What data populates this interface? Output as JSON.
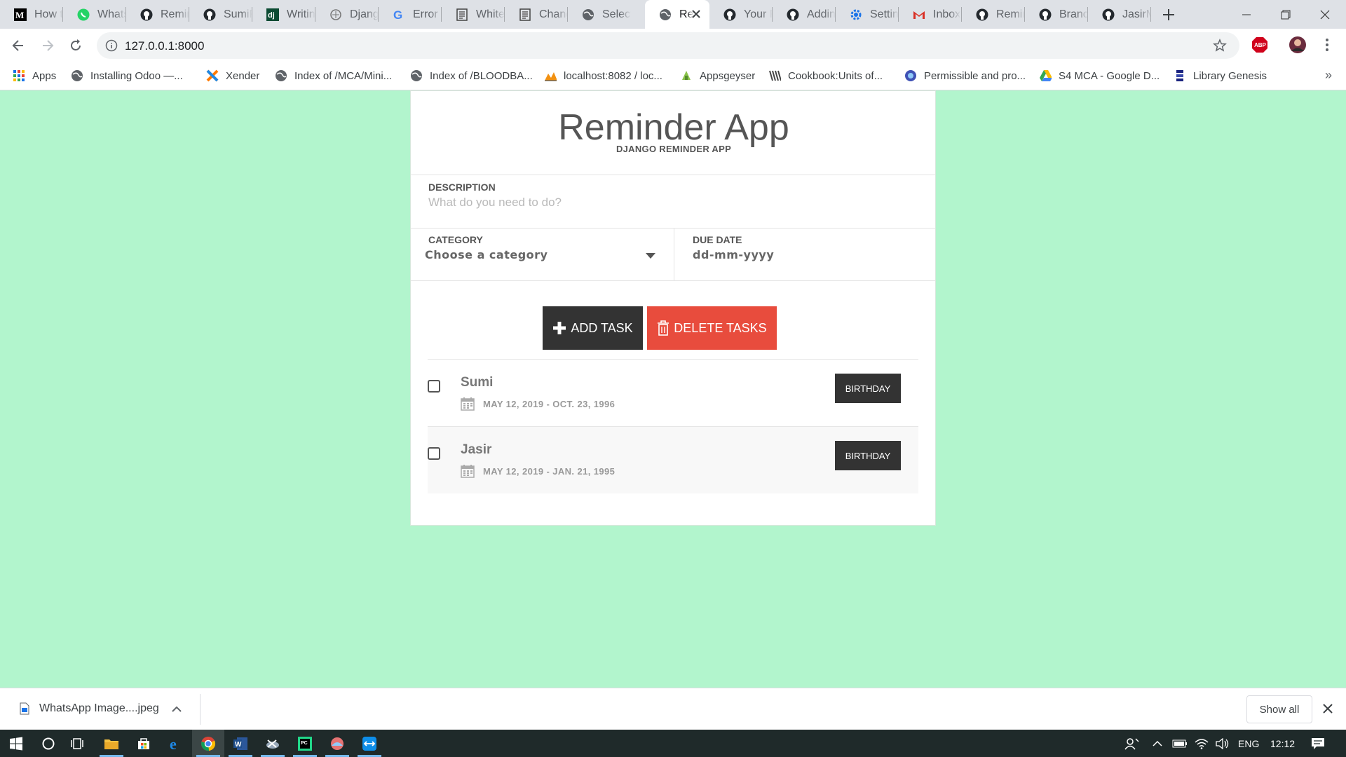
{
  "browser": {
    "tabs": [
      {
        "title": "How t",
        "icon": "medium-icon"
      },
      {
        "title": "Whats",
        "icon": "whatsapp-icon"
      },
      {
        "title": "Remin",
        "icon": "github-icon"
      },
      {
        "title": "SumiP",
        "icon": "github-icon"
      },
      {
        "title": "Writin",
        "icon": "django-icon"
      },
      {
        "title": "Djang",
        "icon": "generic-icon"
      },
      {
        "title": "Error c",
        "icon": "google-icon"
      },
      {
        "title": "White",
        "icon": "doc-icon"
      },
      {
        "title": "Chang",
        "icon": "doc-icon"
      },
      {
        "title": "Select",
        "icon": "globe-icon"
      },
      {
        "title": "Re",
        "icon": "globe-icon",
        "active": true
      },
      {
        "title": "Your F",
        "icon": "github-icon"
      },
      {
        "title": "Addin",
        "icon": "github-icon"
      },
      {
        "title": "Settin",
        "icon": "gear-icon"
      },
      {
        "title": "Inbox",
        "icon": "gmail-icon"
      },
      {
        "title": "Remin",
        "icon": "github-icon"
      },
      {
        "title": "Branc",
        "icon": "github-icon"
      },
      {
        "title": "JasirM",
        "icon": "github-icon"
      }
    ],
    "url": "127.0.0.1:8000",
    "bookmarks": [
      {
        "label": "Apps",
        "icon": "apps-grid-icon"
      },
      {
        "label": "Installing Odoo —...",
        "icon": "globe-icon"
      },
      {
        "label": "Xender",
        "icon": "xender-icon"
      },
      {
        "label": "Index of /MCA/Mini...",
        "icon": "globe-icon"
      },
      {
        "label": "Index of /BLOODBA...",
        "icon": "globe-icon"
      },
      {
        "label": "localhost:8082 / loc...",
        "icon": "phpmyadmin-icon"
      },
      {
        "label": "Appsgeyser",
        "icon": "appsgeyser-icon"
      },
      {
        "label": "Cookbook:Units of...",
        "icon": "wikibooks-icon"
      },
      {
        "label": "Permissible and pro...",
        "icon": "site-icon"
      },
      {
        "label": "S4 MCA - Google D...",
        "icon": "google-drive-icon"
      },
      {
        "label": "Library Genesis",
        "icon": "libgen-icon"
      }
    ],
    "bookmarks_more": "»"
  },
  "app": {
    "title": "Reminder App",
    "subtitle": "DJANGO REMINDER APP",
    "description_label": "DESCRIPTION",
    "description_placeholder": "What do you need to do?",
    "category_label": "CATEGORY",
    "category_selected": "Choose a category",
    "due_date_label": "DUE DATE",
    "due_date_placeholder": "dd-mm-yyyy",
    "add_button": "ADD TASK",
    "delete_button": "DELETE TASKS",
    "tasks": [
      {
        "name": "Sumi",
        "dates": "MAY 12, 2019 - OCT. 23, 1996",
        "category": "BIRTHDAY",
        "checked": false
      },
      {
        "name": "Jasir",
        "dates": "MAY 12, 2019 - JAN. 21, 1995",
        "category": "BIRTHDAY",
        "checked": false
      }
    ]
  },
  "download_shelf": {
    "file_name": "WhatsApp Image....jpeg",
    "show_all": "Show all"
  },
  "taskbar": {
    "language": "ENG",
    "time": "12:12"
  },
  "colors": {
    "page_background": "#b2f5cd",
    "add_button": "#333333",
    "delete_button": "#e84c3d"
  }
}
